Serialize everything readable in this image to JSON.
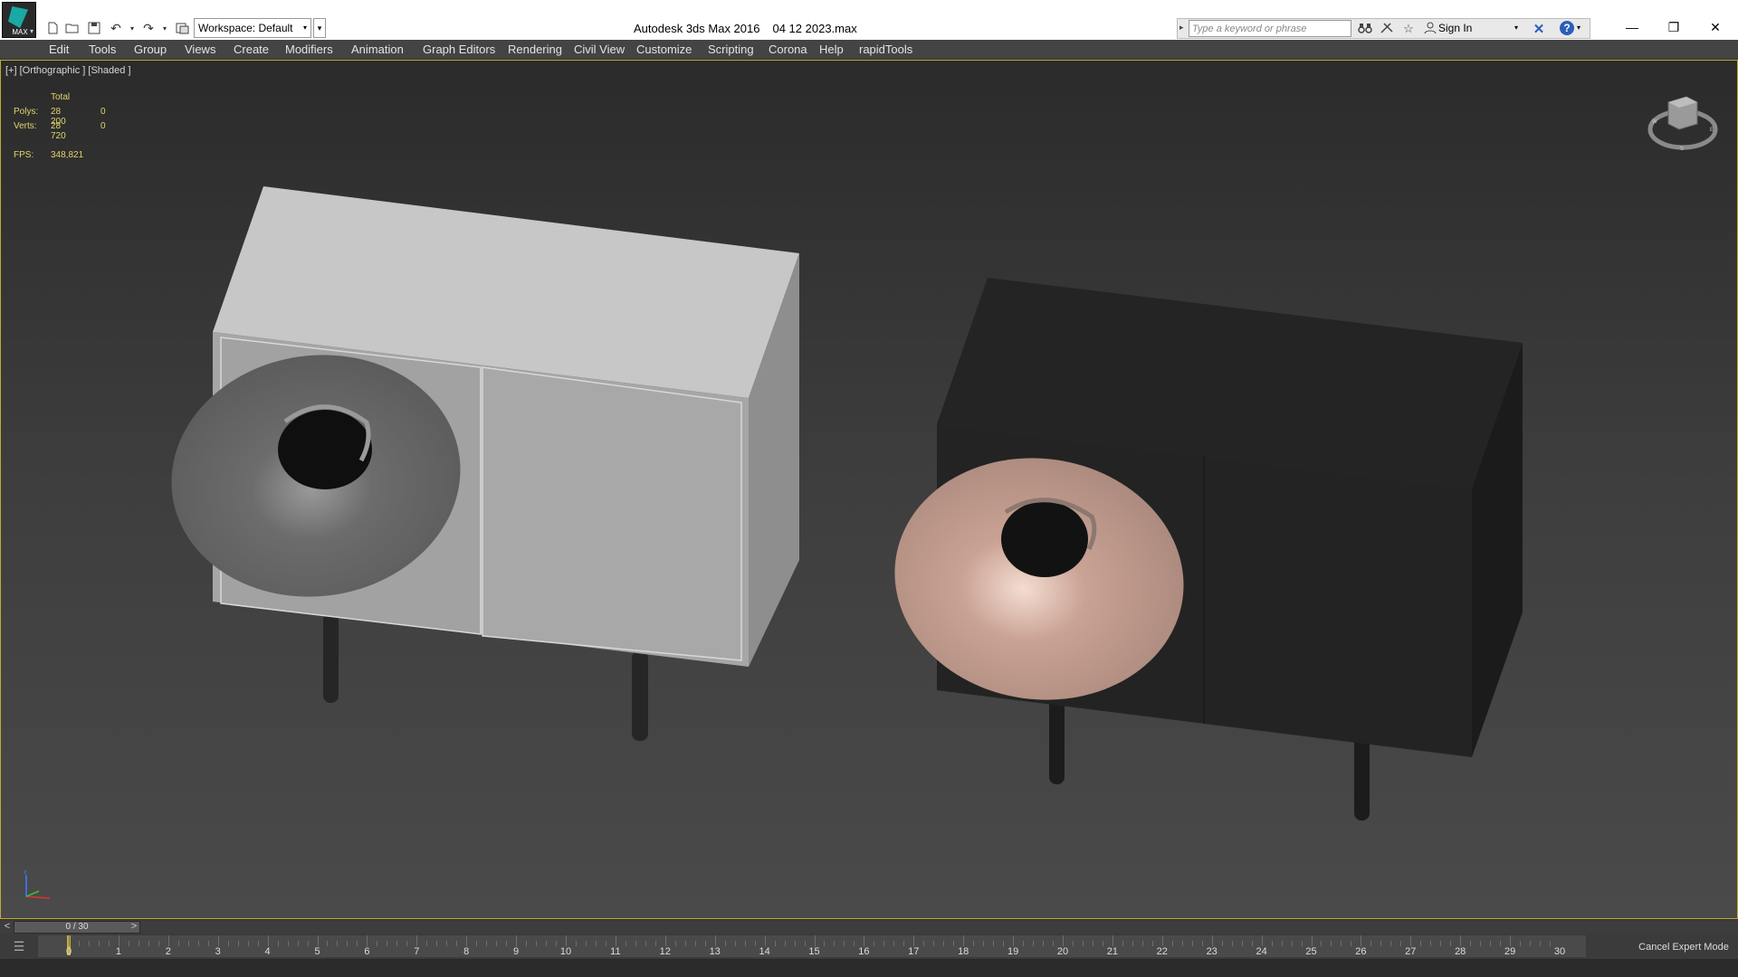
{
  "app": {
    "logo_text": "MAX",
    "title": "Autodesk 3ds Max 2016",
    "file": "04 12 2023.max",
    "workspace": "Workspace: Default"
  },
  "search": {
    "placeholder": "Type a keyword or phrase"
  },
  "infocenter": {
    "sign_in": "Sign In"
  },
  "menu": [
    "Edit",
    "Tools",
    "Group",
    "Views",
    "Create",
    "Modifiers",
    "Animation",
    "Graph Editors",
    "Rendering",
    "Civil View",
    "Customize",
    "Scripting",
    "Corona",
    "Help",
    "rapidTools"
  ],
  "viewport": {
    "label": "[+] [Orthographic ] [Shaded ]",
    "stats": {
      "header": "Total",
      "polys_label": "Polys:",
      "polys_total": "28 200",
      "polys_sel": "0",
      "verts_label": "Verts:",
      "verts_total": "28 720",
      "verts_sel": "0",
      "fps_label": "FPS:",
      "fps_value": "348,821"
    },
    "colors": {
      "selection_border": "#c3a83a",
      "stats_text": "#e1d46a",
      "horn_right": "#c49b8c",
      "cabinet_left": "#bdbdbd",
      "cabinet_right": "#202020"
    }
  },
  "timeslider": {
    "frame_display": "0 / 30",
    "prev": "<",
    "next": ">"
  },
  "trackbar": {
    "ticks": [
      "0",
      "1",
      "2",
      "3",
      "4",
      "5",
      "6",
      "7",
      "8",
      "9",
      "10",
      "11",
      "12",
      "13",
      "14",
      "15",
      "16",
      "17",
      "18",
      "19",
      "20",
      "21",
      "22",
      "23",
      "24",
      "25",
      "26",
      "27",
      "28",
      "29",
      "30"
    ]
  },
  "status": {
    "cancel_expert": "Cancel Expert Mode"
  }
}
